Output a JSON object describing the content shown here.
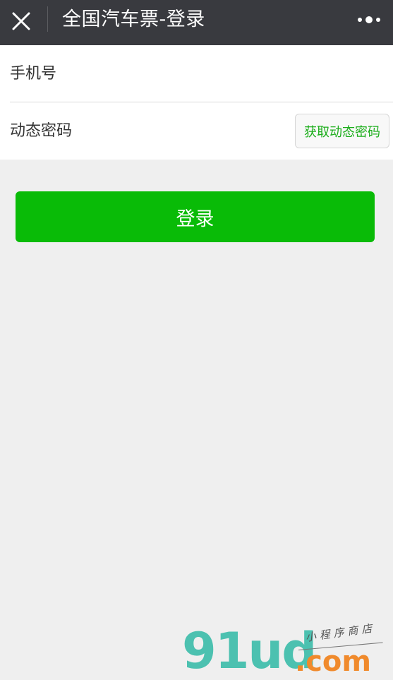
{
  "navbar": {
    "title": "全国汽车票-登录",
    "close_icon": "close-icon",
    "more_icon": "more-dots-icon"
  },
  "form": {
    "phone_placeholder": "手机号",
    "phone_value": "",
    "code_placeholder": "动态密码",
    "code_value": "",
    "get_code_label": "获取动态密码"
  },
  "login": {
    "label": "登录"
  },
  "watermark": {
    "main": "91ud",
    "domain": ".com",
    "tagline": "小程序商店"
  },
  "colors": {
    "navbar_bg": "#393a3f",
    "page_bg": "#efefef",
    "primary_green": "#09bb07",
    "link_green": "#1aad19",
    "watermark_teal": "#4cc1b0",
    "watermark_orange": "#f08a2c"
  }
}
